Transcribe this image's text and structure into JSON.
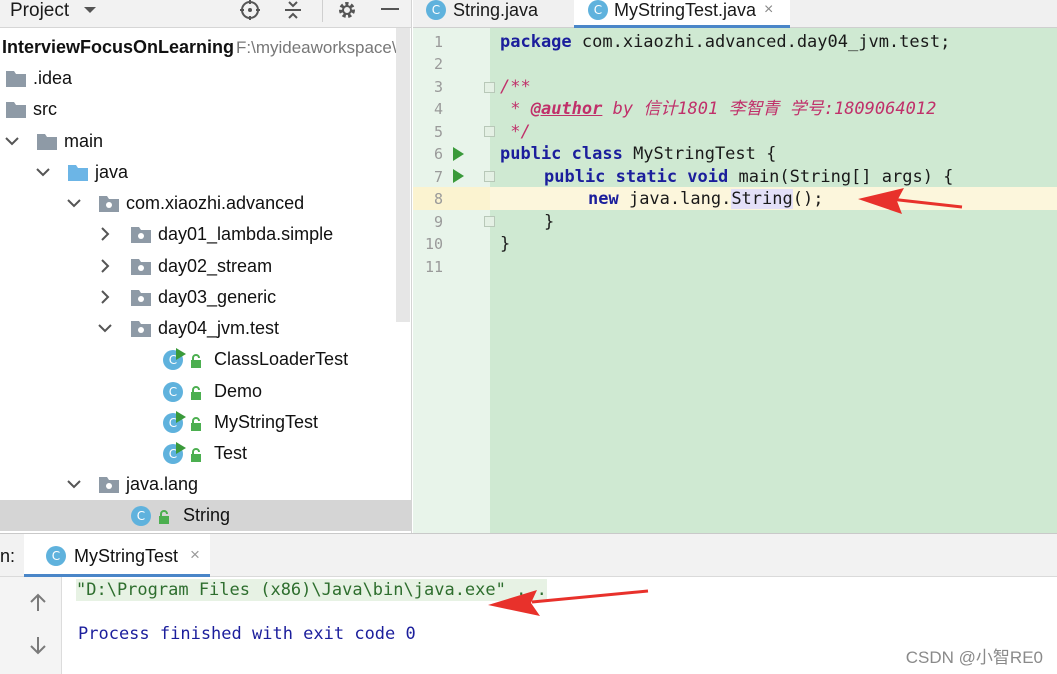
{
  "project_panel": {
    "title": "Project",
    "tree": [
      {
        "label": "InterviewFocusOnLearning",
        "path": "F:\\myideaworkspace\\",
        "bold": true
      },
      {
        "label": ".idea"
      },
      {
        "label": "src"
      },
      {
        "label": "main"
      },
      {
        "label": "java"
      },
      {
        "label": "com.xiaozhi.advanced"
      },
      {
        "label": "day01_lambda.simple"
      },
      {
        "label": "day02_stream"
      },
      {
        "label": "day03_generic"
      },
      {
        "label": "day04_jvm.test"
      },
      {
        "label": "ClassLoaderTest"
      },
      {
        "label": "Demo"
      },
      {
        "label": "MyStringTest"
      },
      {
        "label": "Test"
      },
      {
        "label": "java.lang"
      },
      {
        "label": "String"
      }
    ]
  },
  "editor": {
    "tabs": [
      {
        "label": "String.java",
        "icon": "C"
      },
      {
        "label": "MyStringTest.java",
        "icon": "C",
        "close": "×"
      }
    ],
    "line_numbers": [
      "1",
      "2",
      "3",
      "4",
      "5",
      "6",
      "7",
      "8",
      "9",
      "10",
      "11"
    ],
    "code": {
      "l1_kw": "package",
      "l1_rest": " com.xiaozhi.advanced.day04_jvm.test;",
      "l3": "/**",
      "l4_star": " * ",
      "l4_tag": "@author",
      "l4_rest": " by 信计1801 李智青 学号:1809064012",
      "l5": " */",
      "l6_kw": "public class",
      "l6_rest": " MyStringTest {",
      "l7_kw": "public static void",
      "l7_rest": " main(String[] args) {",
      "l8_kw": "new",
      "l8_pkg": " java.lang.",
      "l8_str": "String",
      "l8_tail": "();",
      "l9": "}",
      "l10": "}"
    }
  },
  "run_panel": {
    "prefix": "n:",
    "tab_label": "MyStringTest",
    "tab_close": "×",
    "console": {
      "command": "\"D:\\Program Files (x86)\\Java\\bin\\java.exe\" ...",
      "exit": "Process finished with exit code 0"
    }
  },
  "watermark": "CSDN @小智RE0",
  "colors": {
    "editor_bg": "#cfe9d2",
    "keyword": "#1b1e9c",
    "comment": "#c0306a",
    "arrow": "#e8312b",
    "class_icon": "#5fb2dd"
  }
}
